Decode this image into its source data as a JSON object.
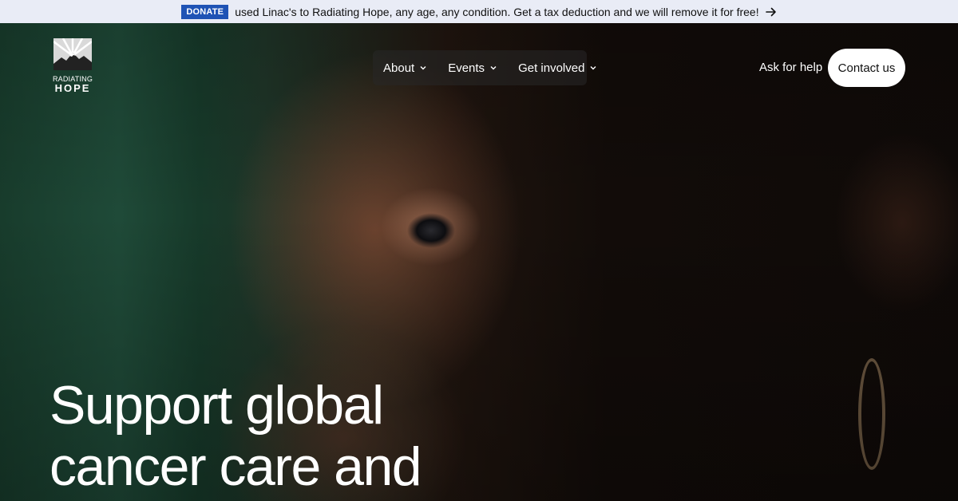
{
  "announcement": {
    "badge": "DONATE",
    "text": "used Linac's to Radiating Hope, any age, any condition. Get a tax deduction and we will remove it for free!",
    "arrow_icon": "arrow-right-icon"
  },
  "logo": {
    "line1": "RADIATING",
    "line2": "HOPE"
  },
  "nav": {
    "items": [
      {
        "label": "About",
        "icon": "chevron-down-icon"
      },
      {
        "label": "Events",
        "icon": "chevron-down-icon"
      },
      {
        "label": "Get involved",
        "icon": "chevron-down-icon"
      }
    ],
    "ask_help": "Ask for help",
    "contact": "Contact us"
  },
  "hero": {
    "headline_lines": [
      "Support global",
      "cancer care and"
    ]
  },
  "colors": {
    "badge": "#1f53b5",
    "announcement_bg": "#e9ecf6",
    "hero_green": "#1f4a38"
  }
}
